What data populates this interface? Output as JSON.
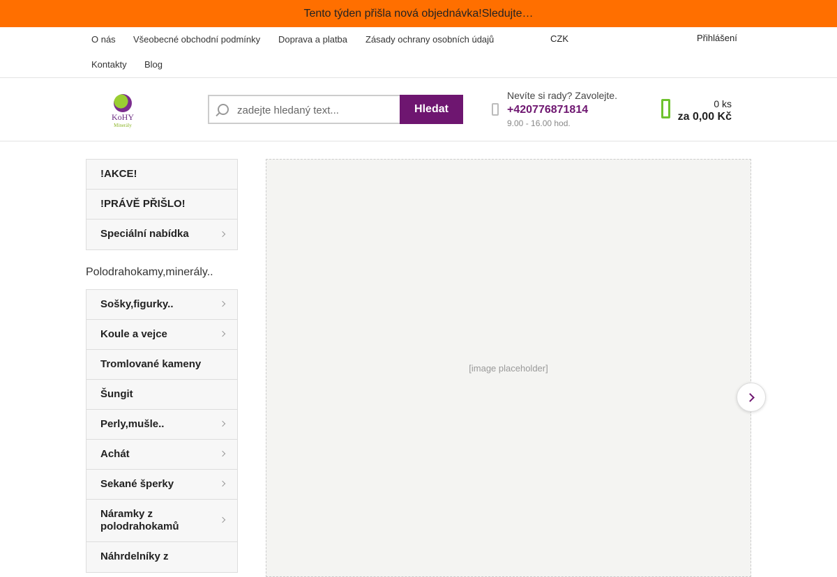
{
  "promo_bar": {
    "text": "Tento týden přišla nová objednávka!Sledujte…"
  },
  "top_nav": {
    "links": [
      "O nás",
      "Všeobecné obchodní podmínky",
      "Doprava a platba",
      "Zásady ochrany osobních údajů",
      "Kontakty",
      "Blog"
    ],
    "currency": "CZK",
    "login": "Přihlášení"
  },
  "header": {
    "logo": {
      "name": "KoHY",
      "subtitle": "Minerály"
    },
    "search": {
      "placeholder": "zadejte hledaný text...",
      "button": "Hledat",
      "icon": "search-icon"
    },
    "contact": {
      "label": "Nevíte si rady? Zavolejte.",
      "phone": "+420776871814",
      "hours": "9.00 - 16.00 hod."
    },
    "cart": {
      "count": "0 ks",
      "total": "za 0,00 Kč"
    }
  },
  "sidebar": {
    "special": [
      {
        "label": "!AKCE!",
        "submenu": false
      },
      {
        "label": "!PRÁVĚ PŘIŠLO!",
        "submenu": false
      },
      {
        "label": "Speciální nabídka",
        "submenu": true
      }
    ],
    "section_title": "Polodrahokamy,minerály..",
    "categories": [
      {
        "label": "Sošky,figurky..",
        "submenu": true
      },
      {
        "label": "Koule a vejce",
        "submenu": true
      },
      {
        "label": "Tromlované kameny",
        "submenu": false
      },
      {
        "label": "Šungit",
        "submenu": false
      },
      {
        "label": "Perly,mušle..",
        "submenu": true
      },
      {
        "label": "Achát",
        "submenu": true
      },
      {
        "label": "Sekané šperky",
        "submenu": true
      },
      {
        "label": "Náramky z polodrahokamů",
        "submenu": true
      },
      {
        "label": "Náhrdelníky z",
        "submenu": false
      }
    ]
  },
  "colors": {
    "promo": "#ff6f00",
    "brand": "#6e1670",
    "cart": "#6ec22e"
  }
}
